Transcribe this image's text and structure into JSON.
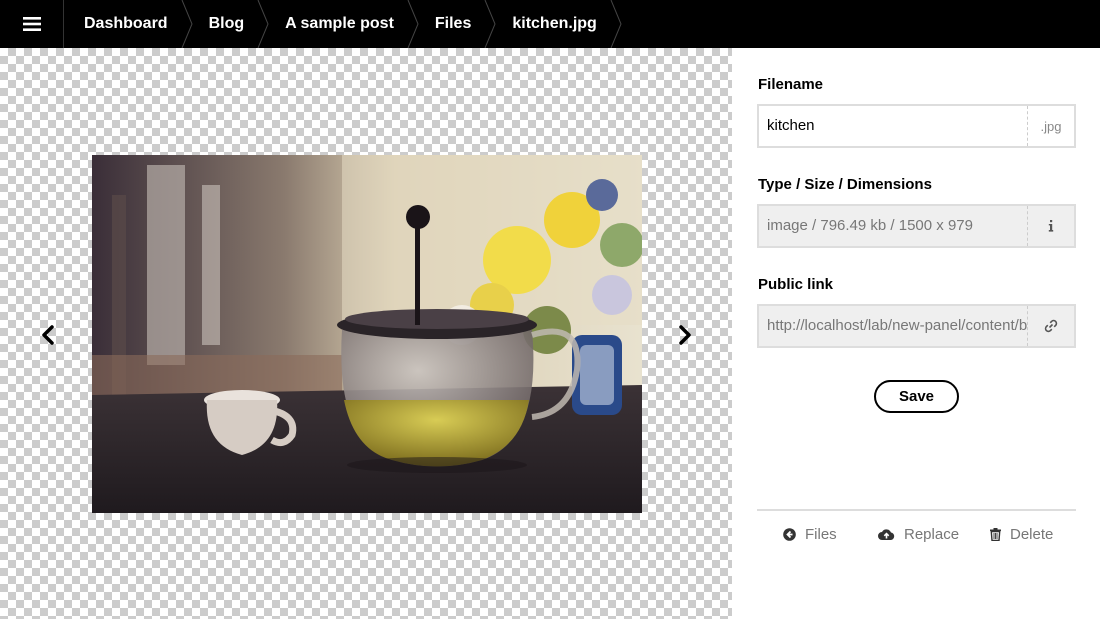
{
  "breadcrumbs": [
    {
      "label": "Dashboard"
    },
    {
      "label": "Blog"
    },
    {
      "label": "A sample post"
    },
    {
      "label": "Files"
    },
    {
      "label": "kitchen.jpg"
    }
  ],
  "sidebar": {
    "filename": {
      "label": "Filename",
      "value": "kitchen",
      "extension": ".jpg"
    },
    "info": {
      "label": "Type / Size / Dimensions",
      "value": "image / 796.49 kb / 1500 x 979",
      "icon": "info-icon"
    },
    "link": {
      "label": "Public link",
      "value": "http://localhost/lab/new-panel/content/blog/a-sample-post/kitchen.jpg",
      "icon": "link-icon"
    },
    "save_label": "Save",
    "actions": {
      "files": "Files",
      "replace": "Replace",
      "delete": "Delete"
    }
  },
  "colors": {
    "topbar": "#000000",
    "muted": "#777777",
    "border": "#dddddd"
  }
}
